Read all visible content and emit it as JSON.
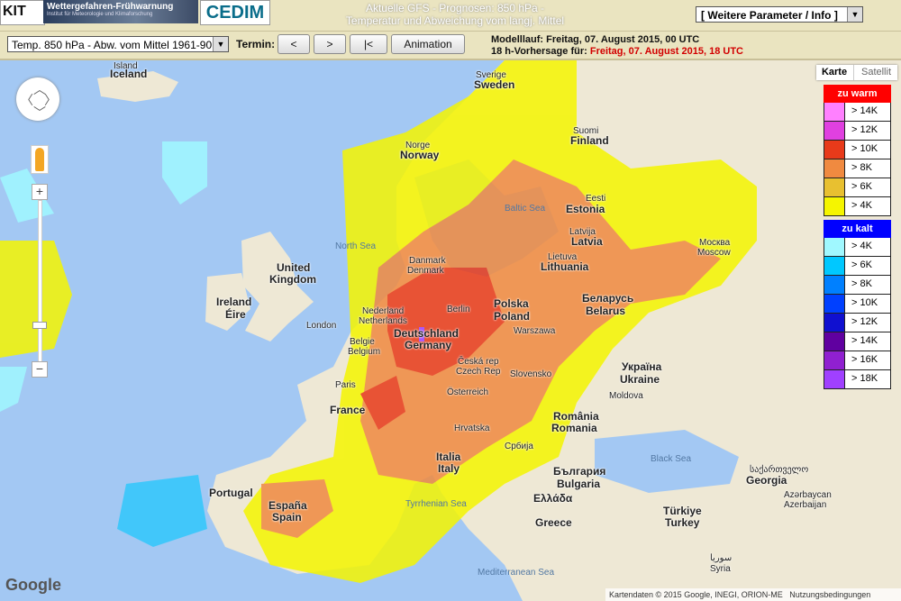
{
  "header": {
    "kit_logo": "KIT",
    "banner_title": "Wettergefahren-Frühwarnung",
    "banner_sub": "Institut für Meteorologie und Klimaforschung",
    "cedim_logo": "CEDIM",
    "title_line1": "Aktuelle GFS - Prognosen: 850 hPa -",
    "title_line2": "Temperatur und Abweichung vom langj. Mittel",
    "param_select": "[ Weitere Parameter / Info ]"
  },
  "controls": {
    "variable_select": "Temp. 850 hPa - Abw. vom Mittel 1961-90",
    "termin_label": "Termin:",
    "prev_button": "<",
    "next_button": ">",
    "first_button": "|<",
    "animation_button": "Animation",
    "modelllauf": "Modelllauf: Freitag, 07. August 2015, 00 UTC",
    "vorhersage_prefix": "18 h-Vorhersage für:",
    "vorhersage_time": "Freitag, 07. August 2015, 18 UTC"
  },
  "map_type": {
    "karte": "Karte",
    "satellit": "Satellit"
  },
  "legend": {
    "warm_title": "zu warm",
    "warm_color": "#ff0000",
    "warm_rows": [
      {
        "label": "> 14K",
        "color": "#ff80ff"
      },
      {
        "label": "> 12K",
        "color": "#e040e0"
      },
      {
        "label": "> 10K",
        "color": "#e83a1a"
      },
      {
        "label": "> 8K",
        "color": "#f08a40"
      },
      {
        "label": "> 6K",
        "color": "#e8c030"
      },
      {
        "label": "> 4K",
        "color": "#f5f500"
      }
    ],
    "cold_title": "zu kalt",
    "cold_color": "#0000ff",
    "cold_rows": [
      {
        "label": "> 4K",
        "color": "#a0f8ff"
      },
      {
        "label": "> 6K",
        "color": "#00c8ff"
      },
      {
        "label": "> 8K",
        "color": "#0080ff"
      },
      {
        "label": "> 10K",
        "color": "#0040ff"
      },
      {
        "label": "> 12K",
        "color": "#1010d0"
      },
      {
        "label": "> 14K",
        "color": "#6000a0"
      },
      {
        "label": "> 16K",
        "color": "#9020d0"
      },
      {
        "label": "> 18K",
        "color": "#a040ff"
      }
    ]
  },
  "map_labels": {
    "island": "Island",
    "iceland": "Iceland",
    "sverige": "Sverige",
    "sweden": "Sweden",
    "norge": "Norge",
    "norway": "Norway",
    "suomi": "Suomi",
    "finland": "Finland",
    "north_sea": "North Sea",
    "baltic_sea": "Baltic Sea",
    "eesti": "Eesti",
    "estonia": "Estonia",
    "latvija": "Latvija",
    "latvia": "Latvia",
    "lietuva": "Lietuva",
    "lithuania": "Lithuania",
    "moskva": "Москва",
    "moscow": "Moscow",
    "danmark": "Danmark",
    "denmark": "Denmark",
    "uk1": "United",
    "uk2": "Kingdom",
    "ireland": "Ireland",
    "eire": "Éire",
    "london": "London",
    "nederland": "Nederland",
    "netherlands": "Netherlands",
    "belgie": "Belgie",
    "belgium": "Belgium",
    "berlin": "Berlin",
    "polska": "Polska",
    "poland": "Poland",
    "warszawa": "Warszawa",
    "belarus_cyr": "Беларусь",
    "belarus": "Belarus",
    "deutschland": "Deutschland",
    "germany": "Germany",
    "ceska": "Česká rep",
    "czech": "Czech Rep",
    "paris": "Paris",
    "france": "France",
    "osterreich": "Österreich",
    "slovensko": "Slovensko",
    "ukraina": "Україна",
    "ukraine": "Ukraine",
    "moldova": "Moldova",
    "romania": "România",
    "romania_en": "Romania",
    "hrvatska": "Hrvatska",
    "srbija": "Србија",
    "italia": "Italia",
    "italy": "Italy",
    "black_sea": "Black Sea",
    "bulgaria_cyr": "България",
    "bulgaria": "Bulgaria",
    "portugal": "Portugal",
    "espana": "España",
    "spain": "Spain",
    "tyrrhenian": "Tyrrhenian Sea",
    "ellada": "Ελλάδα",
    "greece": "Greece",
    "georgia_geo": "საქართველო",
    "georgia": "Georgia",
    "azerbaycan": "Azərbaycan",
    "azerbaijan": "Azerbaijan",
    "turkiye": "Türkiye",
    "turkey": "Turkey",
    "mediterranean": "Mediterranean Sea",
    "suriya": "سوريا",
    "syria": "Syria"
  },
  "footer": {
    "google": "Google",
    "attribution": "Kartendaten © 2015 Google, INEGI, ORION-ME",
    "terms": "Nutzungsbedingungen"
  }
}
